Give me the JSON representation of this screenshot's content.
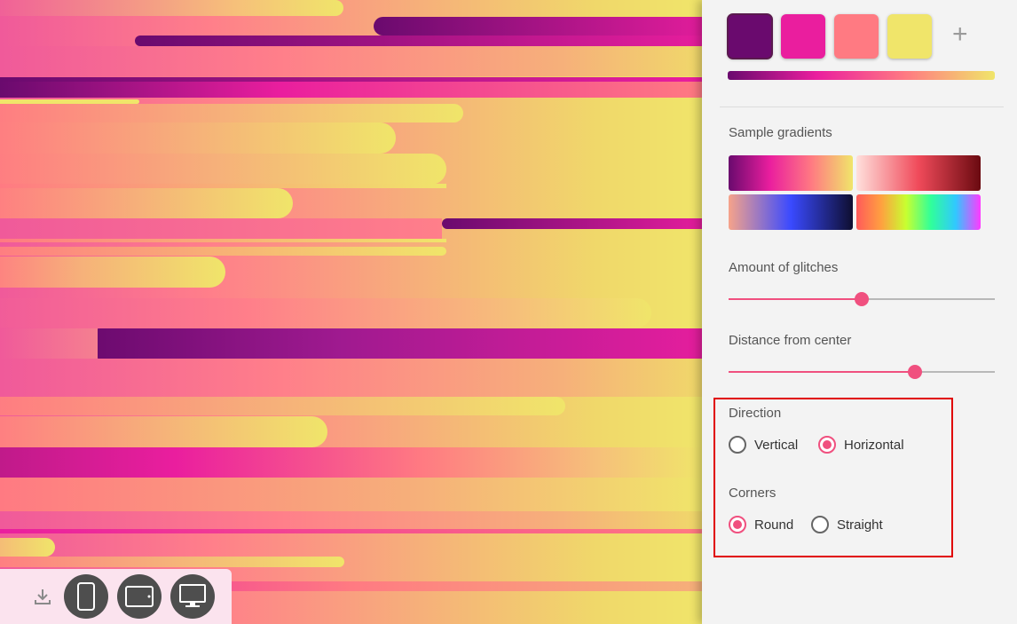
{
  "panel": {
    "palette": {
      "colors": [
        "#6a0a6e",
        "#ea1e9e",
        "#ff7a82",
        "#f0e56a"
      ],
      "selected_index": 0,
      "add_label": "+"
    },
    "sample_gradients": {
      "label": "Sample gradients",
      "tiles": [
        {
          "name": "purple-pink-yellow",
          "colors": [
            "#6a0a6e",
            "#ea1e9e",
            "#ff7a82",
            "#f0e56a"
          ]
        },
        {
          "name": "pink-red-maroon",
          "colors": [
            "#ffe0dc",
            "#f04a5a",
            "#6a0a10"
          ]
        },
        {
          "name": "peach-blue-navy",
          "colors": [
            "#f6a38a",
            "#3a4aff",
            "#0e0e30"
          ]
        },
        {
          "name": "rainbow",
          "colors": [
            "#ff5a5a",
            "#ffa040",
            "#c8ff30",
            "#30ff9a",
            "#30c8ff",
            "#ff3aff"
          ]
        }
      ]
    },
    "glitches": {
      "label": "Amount of glitches",
      "value": 0.5
    },
    "distance": {
      "label": "Distance from center",
      "value": 0.7
    },
    "direction": {
      "label": "Direction",
      "options": [
        "Vertical",
        "Horizontal"
      ],
      "selected": "Horizontal"
    },
    "corners": {
      "label": "Corners",
      "options": [
        "Round",
        "Straight"
      ],
      "selected": "Round"
    }
  },
  "dock": {
    "icons": [
      "download-icon",
      "phone-icon",
      "tablet-icon",
      "desktop-icon"
    ]
  },
  "colors": {
    "accent": "#f0507f",
    "dock_button": "#4e4e4e",
    "highlight": "#e00000"
  }
}
